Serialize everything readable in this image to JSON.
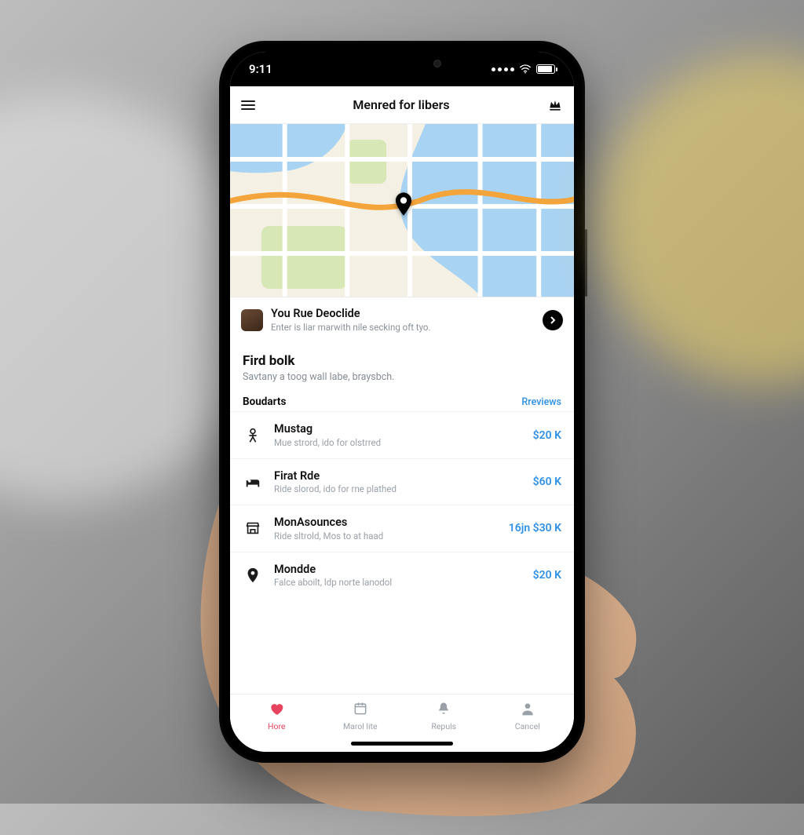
{
  "status": {
    "time": "9:11"
  },
  "header": {
    "title": "Menred for libers"
  },
  "banner": {
    "title": "You Rue Deoclide",
    "subtitle": "Enter is liar marwith nile secking oft tyo."
  },
  "section": {
    "title": "Fird bolk",
    "subtitle": "Savtany a toog wall labe, braysbch."
  },
  "list_header": {
    "title": "Boudarts",
    "link": "Rreviews"
  },
  "rows": [
    {
      "icon": "person",
      "title": "Mustag",
      "sub": "Mue strord, ido for olstrred",
      "price": "$20 K"
    },
    {
      "icon": "bed",
      "title": "Firat Rde",
      "sub": "Ride slorod, ido for rne plathed",
      "price": "$60 K"
    },
    {
      "icon": "store",
      "title": "MonAsounces",
      "sub": "Ride sltrold, Mos to at haad",
      "price": "16jn $30 K"
    },
    {
      "icon": "pin",
      "title": "Mondde",
      "sub": "Falce aboilt, ldp norte lanodol",
      "price": "$20 K"
    }
  ],
  "tabs": [
    {
      "icon": "heart",
      "label": "Hore",
      "active": true
    },
    {
      "icon": "calendar",
      "label": "Marol lite",
      "active": false
    },
    {
      "icon": "bell",
      "label": "Repuls",
      "active": false
    },
    {
      "icon": "user",
      "label": "Cancel",
      "active": false
    }
  ],
  "colors": {
    "accent_blue": "#2d90e6",
    "accent_red": "#e7435e"
  }
}
